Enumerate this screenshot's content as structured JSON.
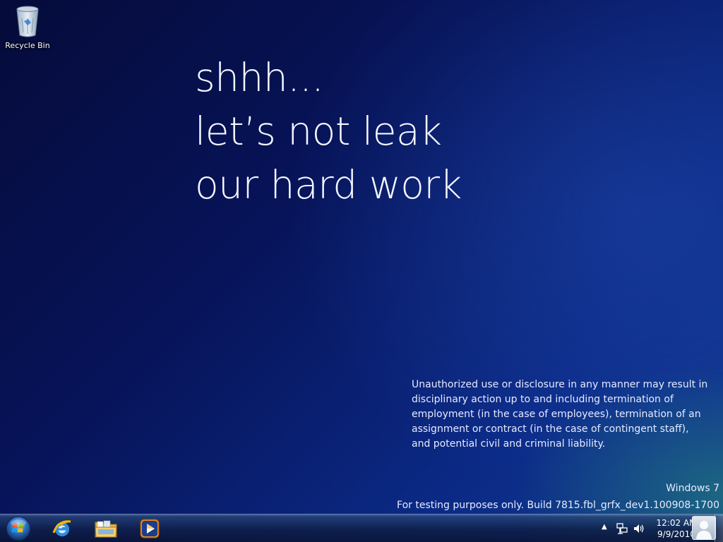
{
  "desktop": {
    "recycle_bin_label": "Recycle Bin"
  },
  "wallpaper": {
    "headline_lines": [
      "shhh...",
      "let’s not leak",
      "our hard work"
    ],
    "disclaimer": "Unauthorized use or disclosure in any manner may result in disciplinary action up to and including termination of employment (in the case of employees), termination of an assignment or contract (in the case of contingent staff), and potential civil and criminal liability."
  },
  "watermark": {
    "os_name": "Windows 7",
    "build_text": "For testing purposes only. Build 7815.fbl_grfx_dev1.100908-1700"
  },
  "taskbar": {
    "pinned": [
      {
        "name": "internet-explorer",
        "icon": "internet-explorer-icon"
      },
      {
        "name": "windows-explorer",
        "icon": "folder-icon"
      },
      {
        "name": "media-player",
        "icon": "media-player-icon"
      }
    ],
    "clock": {
      "time": "12:02 AM",
      "date": "9/9/2010"
    }
  },
  "colors": {
    "wallpaper_dark": "#050b3a",
    "wallpaper_mid": "#0b2a86",
    "accent_teal": "#288c78"
  }
}
